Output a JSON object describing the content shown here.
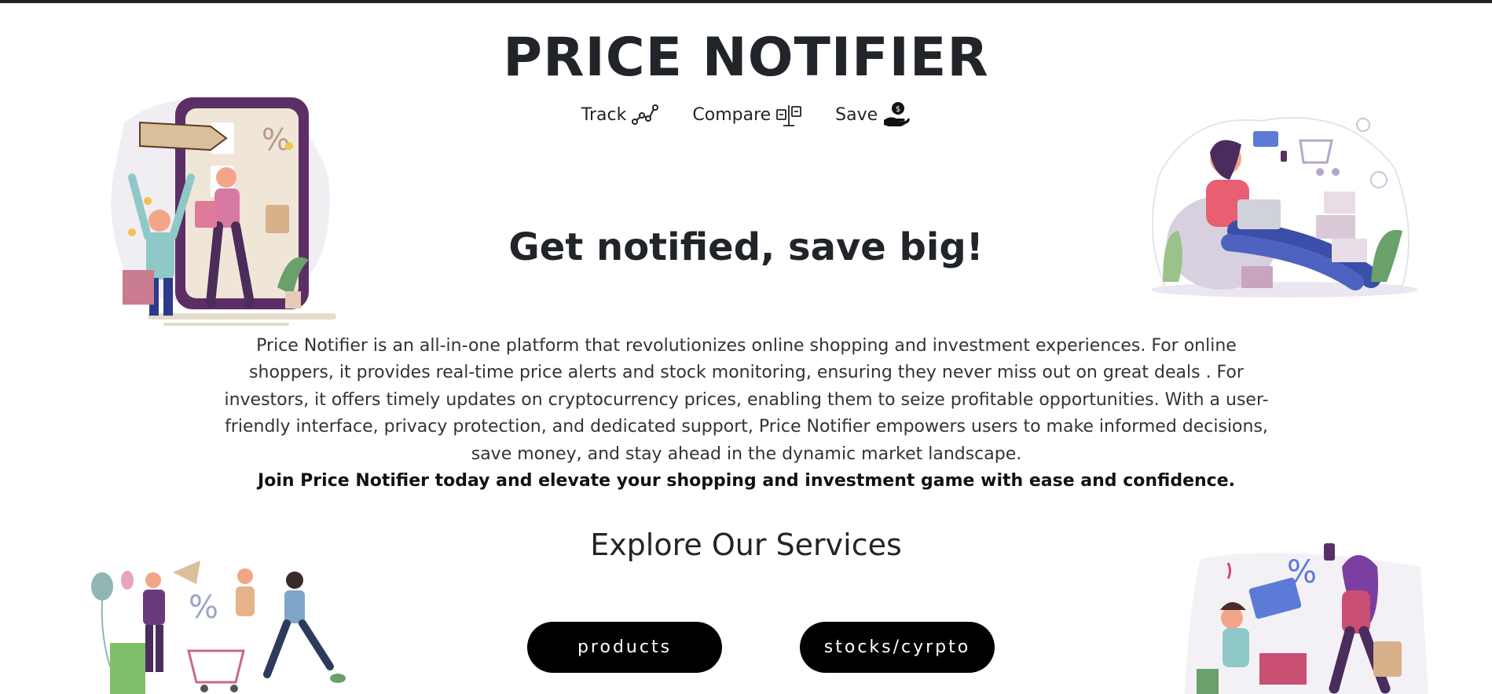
{
  "header": {
    "title": "PRICE NOTIFIER",
    "taglines": [
      {
        "label": "Track",
        "icon": "chart-dots-icon"
      },
      {
        "label": "Compare",
        "icon": "compare-tags-icon"
      },
      {
        "label": "Save",
        "icon": "hand-coin-icon"
      }
    ]
  },
  "hero": {
    "heading": "Get notified, save big!"
  },
  "about": {
    "text": "Price Notifier is an all-in-one platform that revolutionizes online shopping and investment experiences. For online shoppers, it provides real-time price alerts and stock monitoring, ensuring they never miss out on great deals . For investors, it offers timely updates on cryptocurrency prices, enabling them to seize profitable opportunities. With a user-friendly interface, privacy protection, and dedicated support, Price Notifier empowers users to make informed decisions, save money, and stay ahead in the dynamic market landscape.",
    "cta": "Join Price Notifier today and elevate your shopping and investment game with ease and confidence."
  },
  "services": {
    "heading": "Explore Our Services",
    "buttons": [
      {
        "label": "products"
      },
      {
        "label": "stocks/cyrpto"
      }
    ]
  },
  "illustration_text": {
    "percent": "%"
  },
  "colors": {
    "button_bg": "#000000",
    "button_text": "#ffffff",
    "text": "#212529",
    "illustration_purple": "#4a2c5e",
    "illustration_pink": "#e07a9a",
    "illustration_blue": "#3b4fa8"
  }
}
